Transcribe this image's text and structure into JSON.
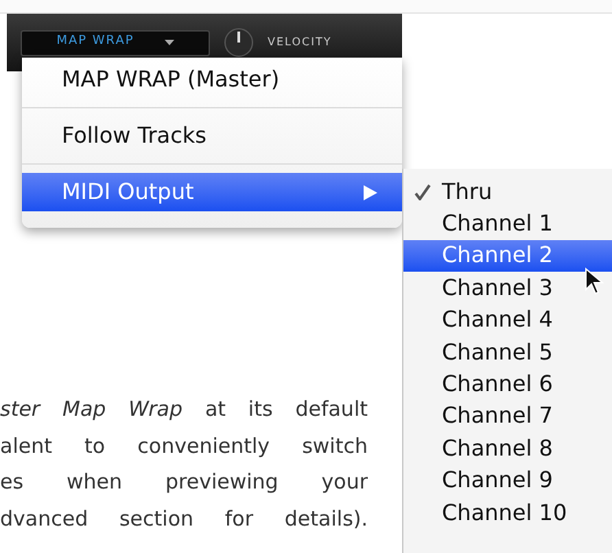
{
  "toolbar": {
    "dropdown": "MAP WRAP",
    "knob_label": "VELOCITY"
  },
  "menu": {
    "items": [
      {
        "label": "MAP WRAP (Master)",
        "selected": false,
        "submenu": false
      },
      {
        "label": "Follow Tracks",
        "selected": false,
        "submenu": false
      },
      {
        "label": "MIDI Output",
        "selected": true,
        "submenu": true
      }
    ]
  },
  "submenu": {
    "items": [
      {
        "label": "Thru",
        "checked": true,
        "selected": false
      },
      {
        "label": "Channel 1",
        "checked": false,
        "selected": false
      },
      {
        "label": "Channel 2",
        "checked": false,
        "selected": true
      },
      {
        "label": "Channel 3",
        "checked": false,
        "selected": false
      },
      {
        "label": "Channel 4",
        "checked": false,
        "selected": false
      },
      {
        "label": "Channel 5",
        "checked": false,
        "selected": false
      },
      {
        "label": "Channel 6",
        "checked": false,
        "selected": false
      },
      {
        "label": "Channel 7",
        "checked": false,
        "selected": false
      },
      {
        "label": "Channel 8",
        "checked": false,
        "selected": false
      },
      {
        "label": "Channel 9",
        "checked": false,
        "selected": false
      },
      {
        "label": "Channel 10",
        "checked": false,
        "selected": false
      }
    ]
  },
  "paragraph": {
    "lines": [
      "*ster Map Wrap* at its default",
      "alent to conveniently switch",
      "es when previewing your",
      "dvanced section for details)."
    ]
  }
}
